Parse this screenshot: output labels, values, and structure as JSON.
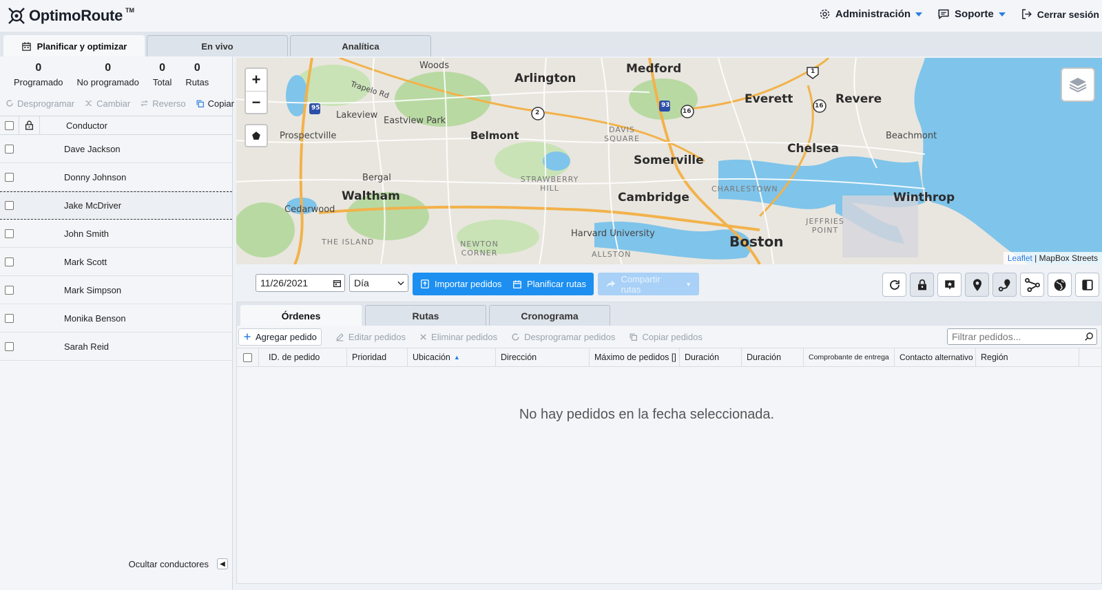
{
  "header": {
    "logo_text": "OptimoRoute",
    "logo_tm": "TM",
    "nav": [
      {
        "label": "Administración",
        "icon": "gear-icon"
      },
      {
        "label": "Soporte",
        "icon": "chat-icon"
      },
      {
        "label": "Cerrar sesión",
        "icon": "logout-icon"
      }
    ]
  },
  "main_tabs": [
    {
      "label": "Planificar y optimizar",
      "active": true
    },
    {
      "label": "En vivo",
      "active": false
    },
    {
      "label": "Analítica",
      "active": false
    }
  ],
  "stats": [
    {
      "value": "0",
      "label": "Programado"
    },
    {
      "value": "0",
      "label": "No programado"
    },
    {
      "value": "0",
      "label": "Total"
    },
    {
      "value": "0",
      "label": "Rutas"
    }
  ],
  "driver_actions": [
    {
      "label": "Desprogramar",
      "enabled": false
    },
    {
      "label": "Cambiar",
      "enabled": false
    },
    {
      "label": "Reverso",
      "enabled": false
    },
    {
      "label": "Copiar",
      "enabled": true
    }
  ],
  "drivers": {
    "column_header": "Conductor",
    "rows": [
      "Dave Jackson",
      "Donny Johnson",
      "Jake McDriver",
      "John Smith",
      "Mark Scott",
      "Mark Simpson",
      "Monika Benson",
      "Sarah Reid"
    ]
  },
  "hide_drivers_label": "Ocultar conductores",
  "map": {
    "cities": [
      "Arlington",
      "Medford",
      "Everett",
      "Revere",
      "Belmont",
      "Somerville",
      "Chelsea",
      "Waltham",
      "Cambridge",
      "Winthrop",
      "Boston"
    ],
    "towns": [
      "Woods",
      "Lakeview",
      "Eastview Park",
      "Prospectville",
      "Beachmont",
      "Cedarwood",
      "Harvard University",
      "Bergal"
    ],
    "areas": [
      "DAVIS SQUARE",
      "STRAWBERRY HILL",
      "CHARLESTOWN",
      "JEFFRIES POINT",
      "THE ISLAND",
      "NEWTON CORNER",
      "ALLSTON"
    ],
    "roads": [
      "Trapelo Rd",
      "95",
      "93",
      "2",
      "16",
      "1"
    ],
    "attribution_link": "Leaflet",
    "attribution_text": " | MapBox Streets",
    "colors": {
      "water": "#7fc4ea",
      "land": "#e9e6df",
      "park": "#b9d9a3",
      "highway": "#f2b24b"
    }
  },
  "toolbar": {
    "date": "11/26/2021",
    "period": "Día",
    "import_label": "Importar pedidos",
    "plan_label": "Planificar rutas",
    "share_label": "Compartir rutas",
    "icon_buttons": [
      "refresh-icon",
      "lock-icon",
      "flag-icon",
      "pin-icon",
      "route-pin-icon",
      "route-icon",
      "globe-icon",
      "panel-icon"
    ]
  },
  "sub_tabs": [
    {
      "label": "Órdenes",
      "active": true
    },
    {
      "label": "Rutas",
      "active": false
    },
    {
      "label": "Cronograma",
      "active": false
    }
  ],
  "order_actions": {
    "add": "Agregar pedido",
    "edit": "Editar pedidos",
    "delete": "Eliminar pedidos",
    "unschedule": "Desprogramar pedidos",
    "copy": "Copiar pedidos"
  },
  "filter_placeholder": "Filtrar pedidos...",
  "order_columns": [
    "ID. de pedido",
    "Prioridad",
    "Ubicación",
    "Dirección",
    "Máximo de pedidos []",
    "Duración",
    "Duración",
    "Comprobante de entrega",
    "Contacto alternativo",
    "Región"
  ],
  "empty_message": "No hay pedidos en la fecha seleccionada.",
  "accent_color": "#1c8ff0"
}
